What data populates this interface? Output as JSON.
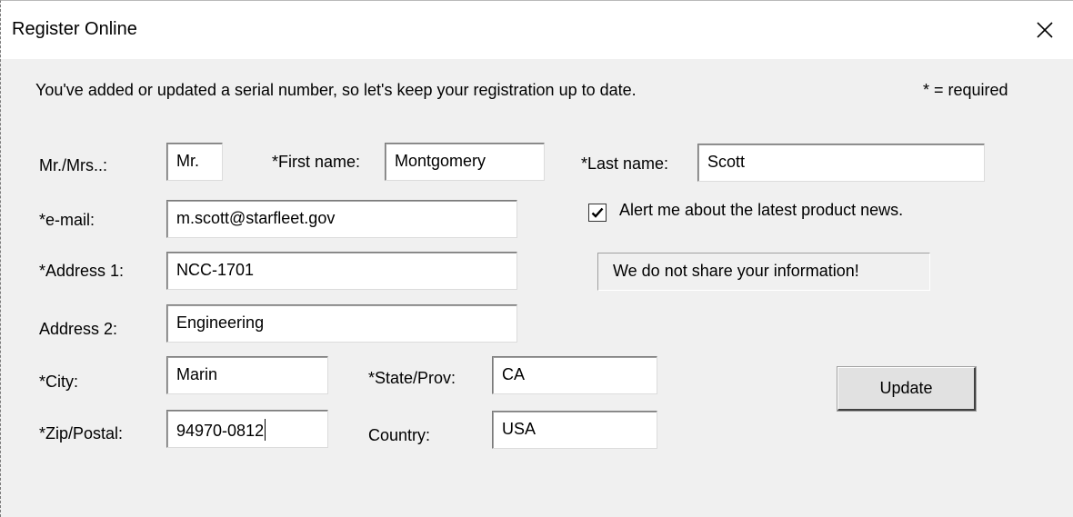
{
  "window": {
    "title": "Register Online",
    "close_icon": "close-icon"
  },
  "intro": {
    "message": "You've added or updated a serial number, so let's keep your registration up to date.",
    "required_note": "* = required"
  },
  "form": {
    "title_label": "Mr./Mrs..:",
    "title_value": "Mr.",
    "first_name_label": "*First name:",
    "first_name_value": "Montgomery",
    "last_name_label": "*Last name:",
    "last_name_value": "Scott",
    "email_label": "*e-mail:",
    "email_value": "m.scott@starfleet.gov",
    "address1_label": "*Address 1:",
    "address1_value": "NCC-1701",
    "address2_label": "Address 2:",
    "address2_value": "Engineering",
    "city_label": "*City:",
    "city_value": "Marin",
    "state_label": "*State/Prov:",
    "state_value": "CA",
    "zip_label": "*Zip/Postal:",
    "zip_value": "94970-0812",
    "country_label": "Country:",
    "country_value": "USA"
  },
  "news_alert": {
    "label": "Alert me about the latest product news.",
    "checked": true
  },
  "privacy_notice": "We do not share your information!",
  "update_button": "Update"
}
